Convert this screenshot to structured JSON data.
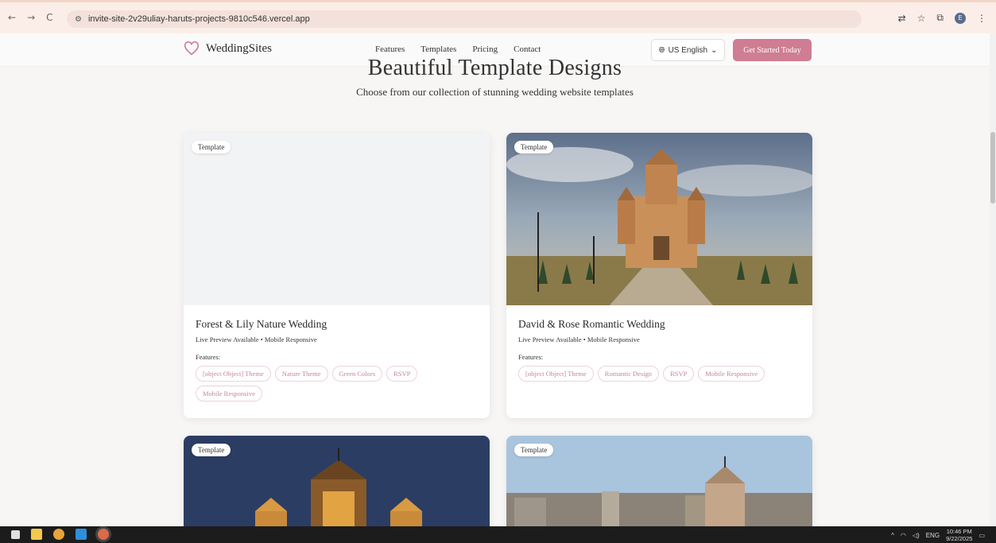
{
  "browser": {
    "back": "←",
    "forward": "→",
    "reload": "C",
    "url": "invite-site-2v29uliay-haruts-projects-9810c546.vercel.app",
    "profile_initial": "E"
  },
  "site": {
    "logo_text": "WeddingSites",
    "nav": [
      "Features",
      "Templates",
      "Pricing",
      "Contact"
    ],
    "language": "US English",
    "cta": "Get Started Today",
    "accent_color": "#cf7d92"
  },
  "section": {
    "title": "Beautiful Template Designs",
    "subtitle": "Choose from our collection of stunning wedding website templates"
  },
  "cards": [
    {
      "badge": "Template",
      "title": "Forest & Lily Nature Wedding",
      "meta": "Live Preview Available • Mobile Responsive",
      "features_label": "Features:",
      "tags": [
        "[object Object] Theme",
        "Nature Theme",
        "Green Colors",
        "RSVP",
        "Mobile Responsive"
      ]
    },
    {
      "badge": "Template",
      "title": "David & Rose Romantic Wedding",
      "meta": "Live Preview Available • Mobile Responsive",
      "features_label": "Features:",
      "tags": [
        "[object Object] Theme",
        "Romantic Design",
        "RSVP",
        "Mobile Responsive"
      ]
    },
    {
      "badge": "Template"
    },
    {
      "badge": "Template"
    }
  ],
  "taskbar": {
    "language": "ENG",
    "time": "10:46 PM",
    "date": "9/22/2025"
  }
}
